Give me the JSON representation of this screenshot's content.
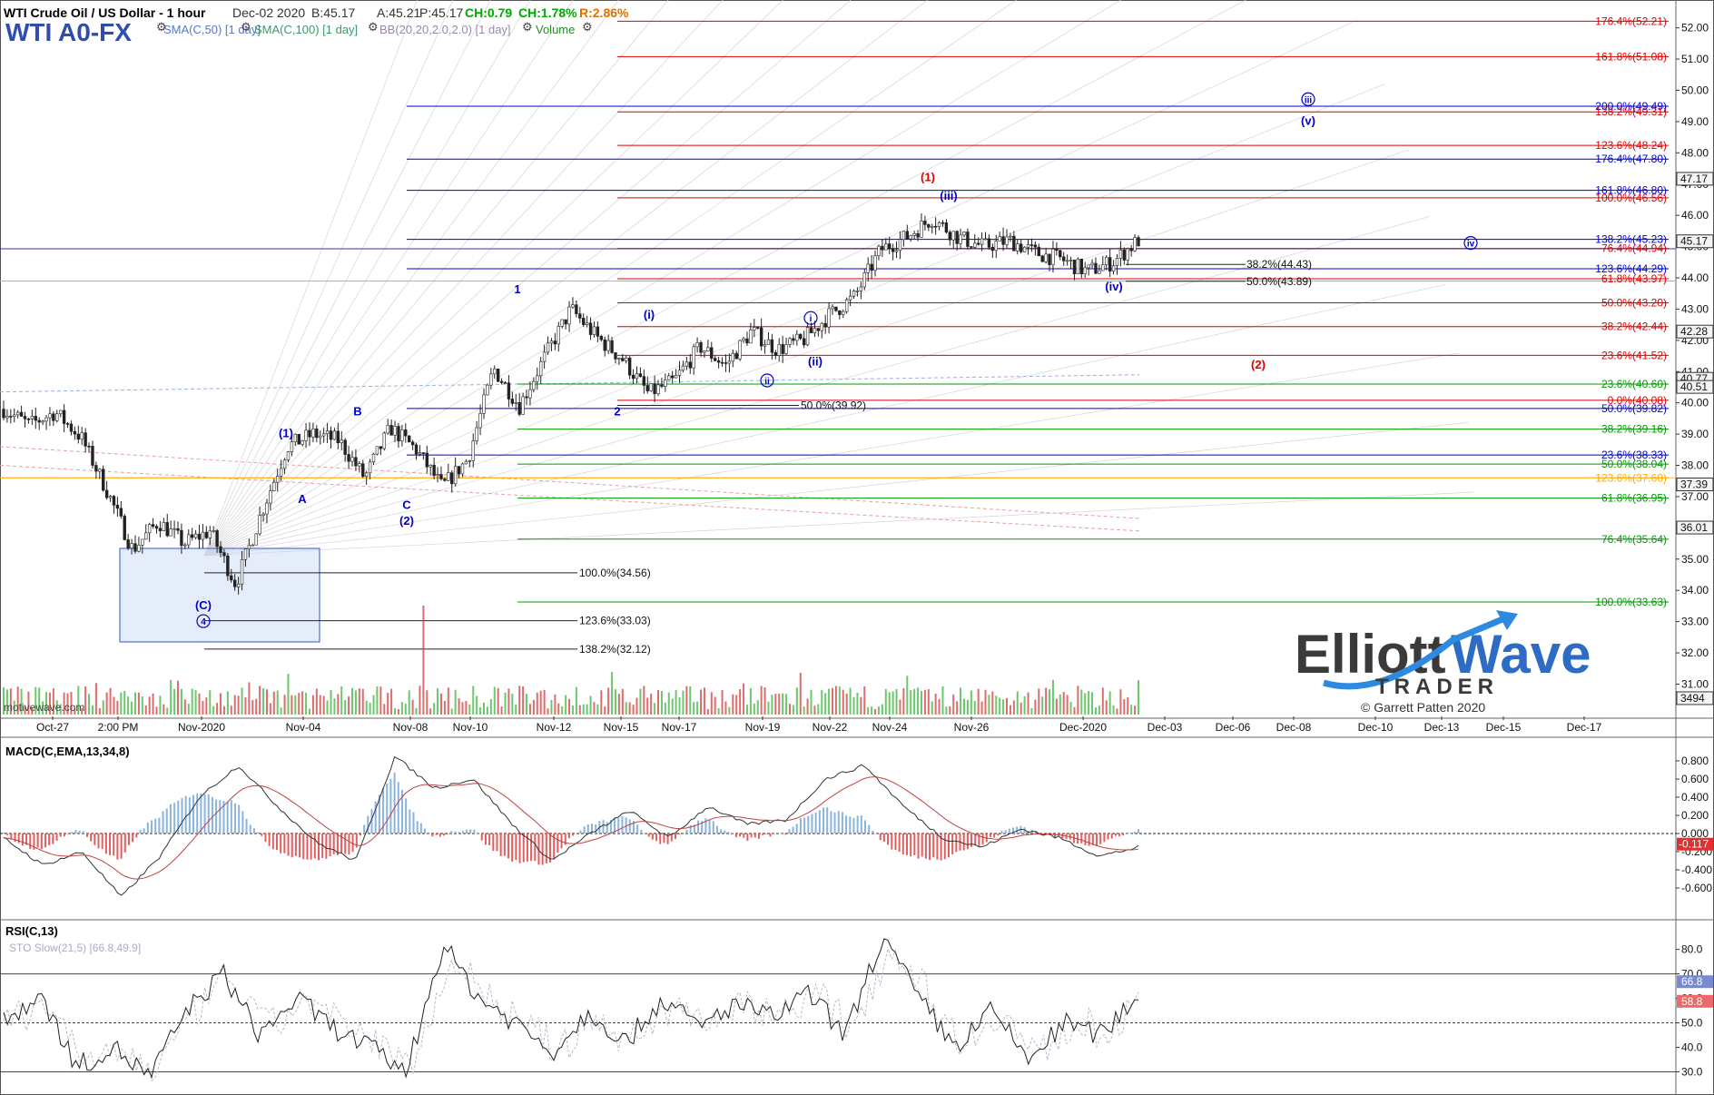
{
  "header": {
    "title": "WTI Crude Oil / US Dollar - 1 hour",
    "date": "Dec-02 2020",
    "bid": "B:45.17",
    "ask": "A:45.21",
    "price": "P:45.17",
    "change": "CH:0.79",
    "change_pct": "CH:1.78%",
    "range": "R:2.86%",
    "symbol": "WTI A0-FX",
    "indicators": [
      "SMA(C,50) [1 day]",
      "SMA(C,100) [1 day]",
      "BB(20,20,2.0,2.0) [1 day]",
      "Volume"
    ],
    "watermark": "motivewave.com"
  },
  "logo": {
    "word1": "Elliott",
    "word2": "Wave",
    "word3": "TRADER",
    "copyright": "© Garrett Patten 2020"
  },
  "colors": {
    "bull": "#0000cc",
    "bear": "#dd0000",
    "fib_green": "#009900",
    "fib_orange": "#ffaa00",
    "macd_pos": "#8ab4dd",
    "macd_neg": "#e06060",
    "vol_green": "#3cb43c",
    "vol_red": "#d23c3c",
    "candle": "#222222",
    "purple": "#5a2a9a"
  },
  "chart_data": [
    {
      "type": "candlestick",
      "title": "WTI Crude Oil / US Dollar - 1 hour",
      "ylim": [
        30.2,
        52.6
      ],
      "y_ticks": [
        31.0,
        32.0,
        33.0,
        34.0,
        35.0,
        36.0,
        37.0,
        38.0,
        39.0,
        40.0,
        41.0,
        42.0,
        43.0,
        44.0,
        45.0,
        46.0,
        47.0,
        48.0,
        49.0,
        50.0,
        51.0,
        52.0
      ],
      "x_ticks": [
        "Oct-27",
        "2:00 PM",
        "Nov-2020",
        "Nov-04",
        "Nov-08",
        "Nov-10",
        "Nov-12",
        "Nov-15",
        "Nov-17",
        "Nov-19",
        "Nov-22",
        "Nov-24",
        "Nov-26",
        "Dec-2020",
        "Dec-03",
        "Dec-06",
        "Dec-08",
        "Dec-10",
        "Dec-13",
        "Dec-15",
        "Dec-17"
      ],
      "price_path": [
        39.8,
        39.3,
        39.7,
        38.9,
        37.2,
        35.3,
        36.2,
        35.5,
        35.9,
        34.2,
        36.5,
        38.6,
        39.0,
        38.8,
        37.6,
        39.2,
        38.5,
        37.3,
        38.2,
        41.1,
        39.9,
        41.5,
        43.0,
        42.1,
        41.4,
        40.3,
        40.7,
        41.8,
        41.2,
        42.3,
        41.7,
        42.0,
        42.8,
        43.4,
        44.9,
        45.3,
        45.9,
        45.3,
        45.0,
        45.2,
        44.8,
        44.6,
        44.2,
        44.5,
        45.2
      ],
      "axis_price_boxes": [
        {
          "value": 47.17,
          "label": "47.17"
        },
        {
          "value": 45.17,
          "label": "45.17"
        },
        {
          "value": 42.28,
          "label": "42.28"
        },
        {
          "value": 40.77,
          "label": "40.77"
        },
        {
          "value": 40.51,
          "label": "40.51"
        },
        {
          "value": 37.39,
          "label": "37.39"
        },
        {
          "value": 36.01,
          "label": "36.01"
        },
        {
          "value": 30.55,
          "label": "3494"
        }
      ],
      "fib_levels": [
        {
          "label": "176.4%(52.21)",
          "value": 52.21,
          "color": "#dd0000"
        },
        {
          "label": "161.8%(51.08)",
          "value": 51.08,
          "color": "#dd0000"
        },
        {
          "label": "200.0%(49.49)",
          "value": 49.49,
          "color": "#0000cc"
        },
        {
          "label": "138.2%(49.31)",
          "value": 49.31,
          "color": "#dd0000"
        },
        {
          "label": "123.6%(48.24)",
          "value": 48.24,
          "color": "#dd0000"
        },
        {
          "label": "176.4%(47.80)",
          "value": 47.8,
          "color": "#0000cc"
        },
        {
          "label": "161.8%(46.80)",
          "value": 46.8,
          "color": "#0000cc"
        },
        {
          "label": "100.0%(46.56)",
          "value": 46.56,
          "color": "#dd0000"
        },
        {
          "label": "138.2%(45.23)",
          "value": 45.23,
          "color": "#0000cc"
        },
        {
          "label": "76.4%(44.94)",
          "value": 44.94,
          "color": "#dd0000"
        },
        {
          "label": "123.6%(44.29)",
          "value": 44.29,
          "color": "#0000cc"
        },
        {
          "label": "61.8%(43.97)",
          "value": 43.97,
          "color": "#dd0000"
        },
        {
          "label": "50.0%(43.20)",
          "value": 43.2,
          "color": "#dd0000"
        },
        {
          "label": "38.2%(42.44)",
          "value": 42.44,
          "color": "#dd0000"
        },
        {
          "label": "23.6%(41.52)",
          "value": 41.52,
          "color": "#dd0000"
        },
        {
          "label": "23.6%(40.60)",
          "value": 40.6,
          "color": "#009900"
        },
        {
          "label": "0.0%(40.08)",
          "value": 40.08,
          "color": "#dd0000"
        },
        {
          "label": "50.0%(39.82)",
          "value": 39.82,
          "color": "#0000cc"
        },
        {
          "label": "38.2%(39.16)",
          "value": 39.16,
          "color": "#009900"
        },
        {
          "label": "23.6%(38.33)",
          "value": 38.33,
          "color": "#0000cc"
        },
        {
          "label": "50.0%(38.04)",
          "value": 38.04,
          "color": "#009900"
        },
        {
          "label": "123.6%(37.60)",
          "value": 37.6,
          "color": "#ffaa00"
        },
        {
          "label": "61.8%(36.95)",
          "value": 36.95,
          "color": "#009900"
        },
        {
          "label": "76.4%(35.64)",
          "value": 35.64,
          "color": "#009900"
        },
        {
          "label": "100.0%(33.63)",
          "value": 33.63,
          "color": "#009900"
        }
      ],
      "inner_fib_levels": [
        {
          "label": "38.2%(44.43)",
          "value": 44.43
        },
        {
          "label": "50.0%(43.89)",
          "value": 43.89
        },
        {
          "label": "50.0%(39.92)",
          "value": 39.92
        },
        {
          "label": "100.0%(34.56)",
          "value": 34.56
        },
        {
          "label": "123.6%(33.03)",
          "value": 33.03
        },
        {
          "label": "138.2%(32.12)",
          "value": 32.12
        }
      ],
      "wave_labels": [
        {
          "text": "(1)",
          "value": 47.1,
          "color": "#dd0000"
        },
        {
          "text": "(iii)",
          "value": 46.5,
          "color": "#0000cc"
        },
        {
          "text": "iii",
          "value": 49.6,
          "color": "#0000cc"
        },
        {
          "text": "(v)",
          "value": 48.9,
          "color": "#0000cc"
        },
        {
          "text": "iv",
          "value": 45.0,
          "color": "#0000cc"
        },
        {
          "text": "(iv)",
          "value": 43.6,
          "color": "#0000cc"
        },
        {
          "text": "(2)",
          "value": 41.1,
          "color": "#dd0000"
        },
        {
          "text": "1",
          "value": 43.5,
          "color": "#0000cc"
        },
        {
          "text": "i",
          "value": 42.6,
          "color": "#0000cc"
        },
        {
          "text": "(i)",
          "value": 42.7,
          "color": "#0000cc"
        },
        {
          "text": "(ii)",
          "value": 41.2,
          "color": "#0000cc"
        },
        {
          "text": "ii",
          "value": 40.6,
          "color": "#0000cc"
        },
        {
          "text": "2",
          "value": 39.6,
          "color": "#0000cc"
        },
        {
          "text": "(1)",
          "value": 38.9,
          "color": "#0000cc"
        },
        {
          "text": "B",
          "value": 39.6,
          "color": "#0000cc"
        },
        {
          "text": "A",
          "value": 36.8,
          "color": "#0000cc"
        },
        {
          "text": "C",
          "value": 36.6,
          "color": "#0000cc"
        },
        {
          "text": "(2)",
          "value": 36.1,
          "color": "#0000cc"
        },
        {
          "text": "(C)",
          "value": 33.4,
          "color": "#0000cc"
        },
        {
          "text": "4",
          "value": 32.9,
          "color": "#0000cc"
        }
      ]
    },
    {
      "type": "bar",
      "title": "MACD(C,EMA,13,34,8)",
      "ylim": [
        -0.8,
        0.9
      ],
      "y_ticks": [
        0.8,
        0.6,
        0.4,
        0.2,
        0.0,
        -0.2,
        -0.4,
        -0.6
      ],
      "y_tick_labels": [
        "0.800",
        "0.600",
        "0.400",
        "0.200",
        "0.000",
        "-0.200",
        "-0.400",
        "-0.600"
      ],
      "current_value_label": "-0.117",
      "current_value": -0.117,
      "macd_path": [
        -0.05,
        -0.35,
        -0.2,
        -0.7,
        -0.25,
        0.4,
        0.75,
        0.3,
        -0.1,
        -0.3,
        0.85,
        0.5,
        0.6,
        0.1,
        -0.3,
        0.0,
        0.25,
        -0.05,
        0.3,
        0.1,
        0.15,
        0.6,
        0.75,
        0.3,
        -0.05,
        -0.15,
        0.05,
        -0.05,
        -0.25,
        -0.15
      ]
    },
    {
      "type": "line",
      "title": "RSI(C,13)",
      "legend": [
        "STO Slow(21,5) [66.8,49.9]"
      ],
      "ylim": [
        25,
        88
      ],
      "y_ticks": [
        80,
        70,
        60,
        50,
        40,
        30
      ],
      "y_tick_labels": [
        "80.0",
        "70.0",
        "60.0",
        "50.0",
        "40.0",
        "30.0"
      ],
      "current_value_labels": [
        {
          "value": 66.8,
          "label": "66.8"
        },
        {
          "value": 58.8,
          "label": "58.8"
        }
      ],
      "rsi_path": [
        50,
        62,
        32,
        40,
        28,
        55,
        70,
        45,
        60,
        48,
        40,
        30,
        82,
        60,
        50,
        38,
        55,
        42,
        60,
        48,
        58,
        52,
        62,
        45,
        85,
        60,
        40,
        55,
        35,
        50,
        45,
        62
      ]
    }
  ]
}
